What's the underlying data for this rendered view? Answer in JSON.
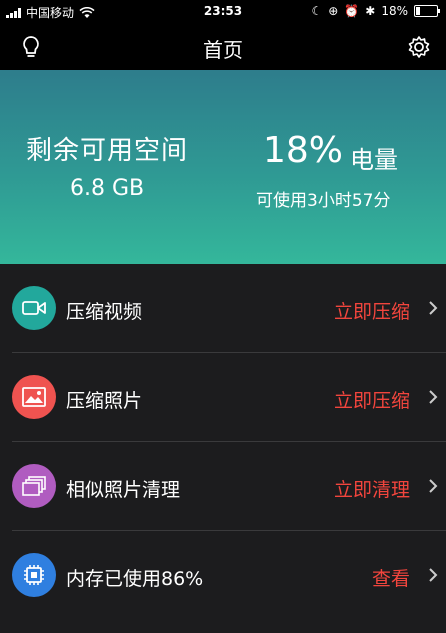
{
  "status_bar": {
    "carrier": "中国移动",
    "time": "23:53",
    "battery_text": "18%",
    "battery_level": 0.18
  },
  "nav": {
    "title": "首页",
    "left_icon": "lightbulb-icon",
    "right_icon": "gear-icon"
  },
  "hero": {
    "storage_title": "剩余可用空间",
    "storage_value": "6.8 GB",
    "battery_percent": "18%",
    "battery_label": "电量",
    "battery_remaining": "可使用3小时57分",
    "gradient_colors": [
      "#2e7d8c",
      "#34b79b"
    ]
  },
  "list": {
    "items": [
      {
        "label": "压缩视频",
        "action": "立即压缩",
        "icon": "video-camera-icon",
        "icon_color": "#22a89c"
      },
      {
        "label": "压缩照片",
        "action": "立即压缩",
        "icon": "image-icon",
        "icon_color": "#ef5350"
      },
      {
        "label": "相似照片清理",
        "action": "立即清理",
        "icon": "photo-stack-icon",
        "icon_color": "#b05cc0"
      },
      {
        "label": "内存已使用86%",
        "action": "查看",
        "icon": "chip-icon",
        "icon_color": "#2f7fe0"
      }
    ]
  },
  "colors": {
    "accent_red": "#f2453d",
    "background": "#1c1c1e"
  }
}
